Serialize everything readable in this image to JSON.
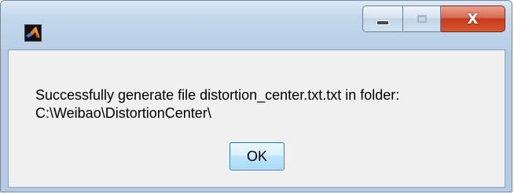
{
  "window": {
    "caption_buttons": {
      "minimize_icon": "minimize-icon",
      "maximize_icon": "maximize-icon",
      "close_glyph": "X"
    },
    "app_icon": "matlab-logo-icon"
  },
  "dialog": {
    "message_line1": "Successfully generate file distortion_center.txt.txt in folder:",
    "message_line2": "C:\\Weibao\\DistortionCenter\\",
    "ok_label": "OK"
  },
  "colors": {
    "close_button": "#c6391d",
    "ok_button_border": "#3c7fb1",
    "client_background": "#f0f0f0"
  }
}
